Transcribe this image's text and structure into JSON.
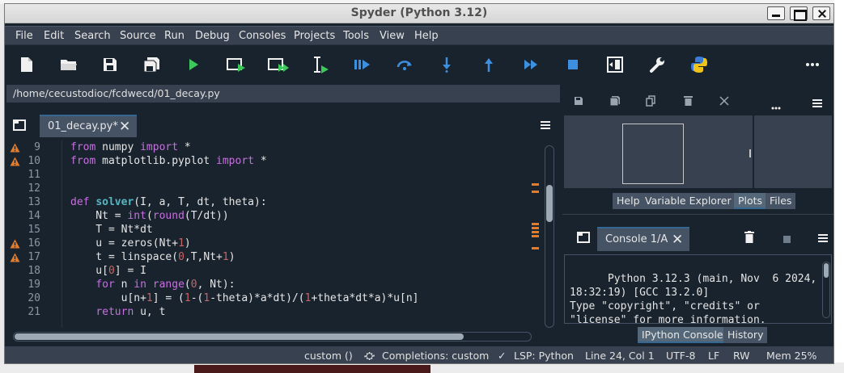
{
  "window": {
    "title": "Spyder (Python 3.12)"
  },
  "menu": [
    "File",
    "Edit",
    "Search",
    "Source",
    "Run",
    "Debug",
    "Consoles",
    "Projects",
    "Tools",
    "View",
    "Help"
  ],
  "toolbar_icons": [
    "new-file-icon",
    "open-folder-icon",
    "save-icon",
    "save-all-icon",
    "run-icon",
    "run-cell-icon",
    "run-cell-advance-icon",
    "run-selection-icon",
    "debug-icon",
    "step-over-icon",
    "step-into-icon",
    "step-return-icon",
    "continue-icon",
    "stop-icon",
    "maximize-pane-icon",
    "preferences-icon",
    "python-path-icon",
    "more-options-icon"
  ],
  "editor": {
    "path": "/home/cecustodioc/fcdwecd/01_decay.py",
    "tab_label": "01_decay.py*",
    "lines": [
      {
        "num": "9",
        "warn": true,
        "text": "from numpy import *"
      },
      {
        "num": "10",
        "warn": true,
        "text": "from matplotlib.pyplot import *"
      },
      {
        "num": "11",
        "warn": false,
        "text": ""
      },
      {
        "num": "12",
        "warn": false,
        "text": ""
      },
      {
        "num": "13",
        "warn": false,
        "text": "def solver(I, a, T, dt, theta):"
      },
      {
        "num": "14",
        "warn": false,
        "text": "    Nt = int(round(T/dt))"
      },
      {
        "num": "15",
        "warn": false,
        "text": "    T = Nt*dt"
      },
      {
        "num": "16",
        "warn": true,
        "text": "    u = zeros(Nt+1)"
      },
      {
        "num": "17",
        "warn": true,
        "text": "    t = linspace(0,T,Nt+1)"
      },
      {
        "num": "18",
        "warn": false,
        "text": "    u[0] = I"
      },
      {
        "num": "19",
        "warn": false,
        "text": "    for n in range(0, Nt):"
      },
      {
        "num": "20",
        "warn": false,
        "text": "        u[n+1] = (1-(1-theta)*a*dt)/(1+theta*dt*a)*u[n]"
      },
      {
        "num": "21",
        "warn": false,
        "text": "    return u, t"
      }
    ]
  },
  "plots_pane": {
    "tabs": [
      "Help",
      "Variable Explorer",
      "Plots",
      "Files"
    ],
    "active_tab": "Plots"
  },
  "console_pane": {
    "tab_label": "Console 1/A",
    "output": "Python 3.12.3 (main, Nov  6 2024,\n18:32:19) [GCC 13.2.0]\nType \"copyright\", \"credits\" or\n\"license\" for more information.",
    "tabs": [
      "IPython Console",
      "History"
    ],
    "active_tab": "IPython Console"
  },
  "status": {
    "custom": "custom ()",
    "completions": "Completions: custom",
    "lsp": "LSP: Python",
    "position": "Line 24, Col 1",
    "encoding": "UTF-8",
    "eol": "LF",
    "mode": "RW",
    "memory": "Mem 25%"
  },
  "colors": {
    "background": "#19232d",
    "panel": "#37414f",
    "tab": "#455364",
    "accent": "#346792",
    "keyword": "#c670e0",
    "function": "#56b6c2",
    "warning": "#e27b2a"
  }
}
